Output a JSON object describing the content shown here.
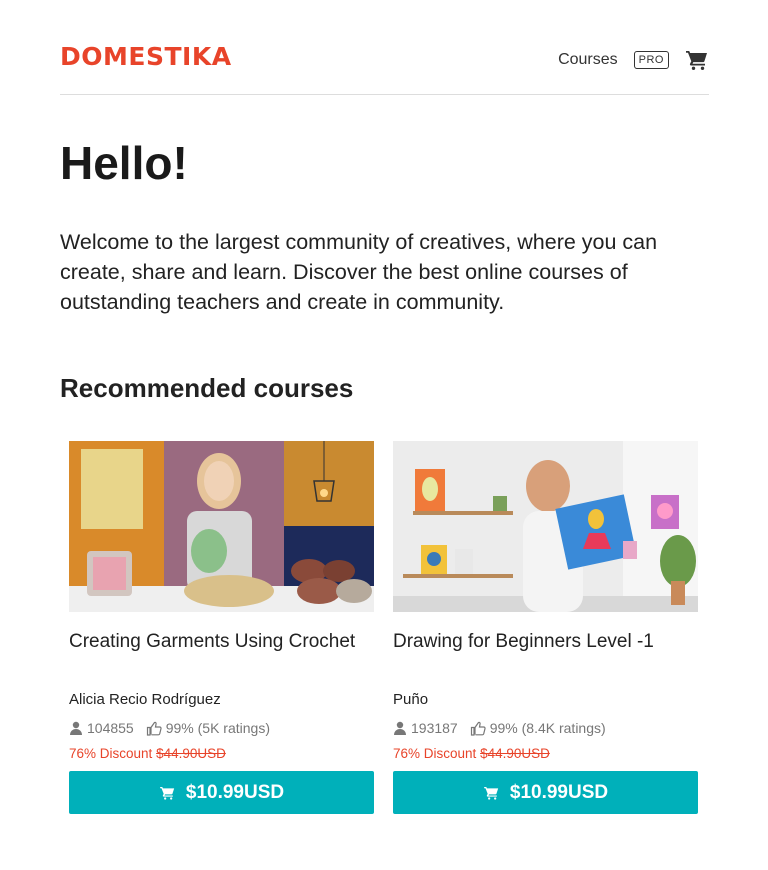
{
  "header": {
    "logo": "DOMESTIKA",
    "nav_courses": "Courses",
    "pro_badge": "PRO"
  },
  "hero": {
    "title": "Hello!",
    "text": "Welcome to the largest community of creatives, where you can create, share and learn. Discover the best online courses of outstanding teachers and create in community."
  },
  "recommended": {
    "title": "Recommended courses",
    "courses": [
      {
        "title": "Creating Garments Using Crochet",
        "teacher": "Alicia Recio Rodríguez",
        "students": "104855",
        "rating": "99% (5K ratings)",
        "discount": "76% Discount",
        "old_price": "$44.90USD",
        "price": "$10.99USD"
      },
      {
        "title": "Drawing for Beginners Level -1",
        "teacher": "Puño",
        "students": "193187",
        "rating": "99% (8.4K ratings)",
        "discount": "76% Discount",
        "old_price": "$44.90USD",
        "price": "$10.99USD"
      }
    ]
  },
  "colors": {
    "brand": "#e8442a",
    "button": "#00b0ba"
  }
}
